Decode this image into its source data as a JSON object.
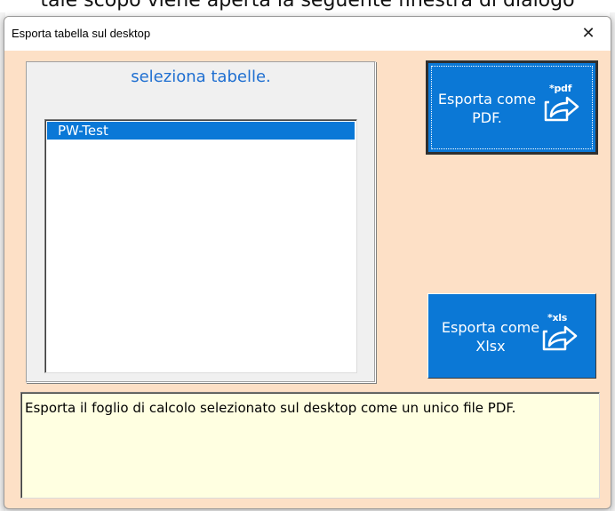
{
  "background": {
    "cropped_text": "tale scopo viene aperta la seguente finestra di dialogo"
  },
  "window": {
    "title": "Esporta tabella sul desktop",
    "close_glyph": "✕",
    "background_color": "#fde0c6"
  },
  "table_frame": {
    "caption": "seleziona tabelle.",
    "caption_color": "#1f6fd1",
    "items": [
      {
        "label": "PW-Test",
        "selected": true
      }
    ]
  },
  "buttons": {
    "pdf": {
      "label_line1": "Esporta come",
      "label_line2": "PDF.",
      "icon_tag": "*pdf",
      "icon": "export-arrow-icon",
      "color": "#0b78d6"
    },
    "xlsx": {
      "label_line1": "Esporta come",
      "label_line2": "Xlsx",
      "icon_tag": "*xls",
      "icon": "export-arrow-icon",
      "color": "#0b78d6"
    }
  },
  "description": {
    "text": "Esporta il foglio di calcolo selezionato sul desktop come un unico file PDF.",
    "background_color": "#ffffe1"
  }
}
